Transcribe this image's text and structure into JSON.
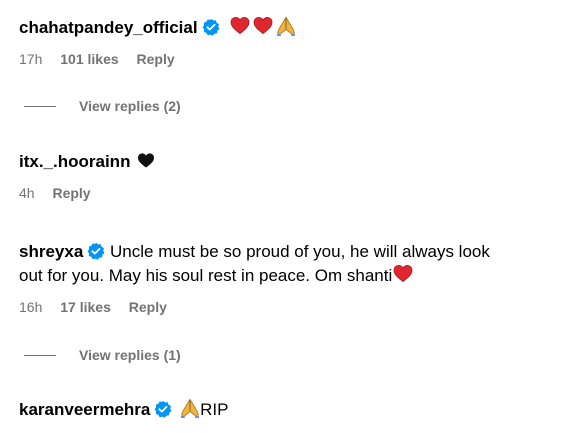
{
  "comments": [
    {
      "username": "chahatpandey_official",
      "verified": true,
      "text": "",
      "emojis": [
        "heart-icon",
        "heart-icon",
        "pray-icon"
      ],
      "time": "17h",
      "likes": "101 likes",
      "reply": "Reply",
      "view_replies": "View replies (2)"
    },
    {
      "username": "itx._.hoorainn",
      "verified": false,
      "text": "",
      "emojis": [
        "black-heart-icon"
      ],
      "time": "4h",
      "likes": "",
      "reply": "Reply"
    },
    {
      "username": "shreyxa",
      "verified": true,
      "text_line1": "Uncle must be so proud of you, he will always look",
      "text_line2": "out for you. May his soul rest in peace. Om shanti",
      "emojis": [
        "heart-icon"
      ],
      "time": "16h",
      "likes": "17 likes",
      "reply": "Reply",
      "view_replies": "View replies (1)"
    },
    {
      "username": "karanveermehra",
      "verified": true,
      "text": "RIP",
      "emojis": [
        "pray-icon"
      ]
    }
  ],
  "colors": {
    "verified": "#0095f6",
    "meta": "#737373",
    "heart": "#e0262f"
  }
}
